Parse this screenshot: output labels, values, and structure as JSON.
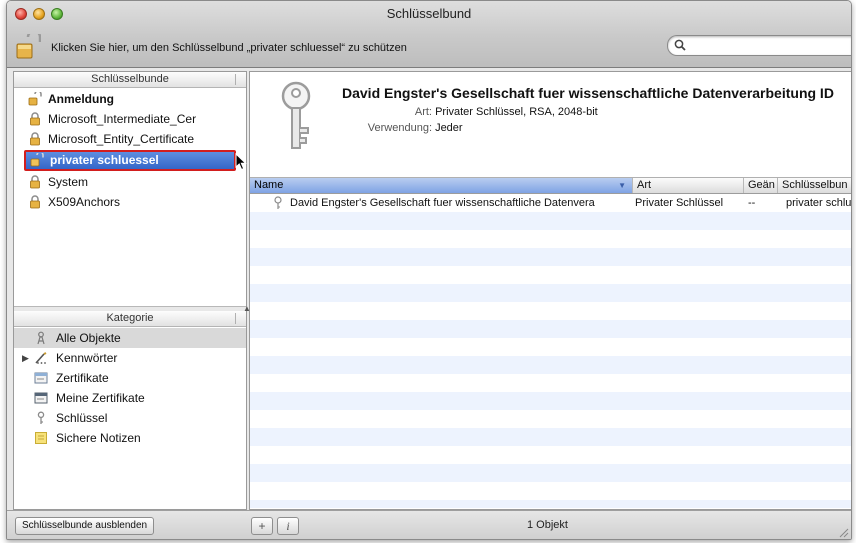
{
  "window": {
    "title": "Schlüsselbund"
  },
  "toolbar": {
    "lock_message": "Klicken Sie hier, um den Schlüsselbund „privater schluessel“ zu schützen",
    "search_placeholder": ""
  },
  "sidebar": {
    "keychains_header": "Schlüsselbunde",
    "keychains": [
      {
        "label": "Anmeldung",
        "icon": "open-lock-icon"
      },
      {
        "label": "Microsoft_Intermediate_Cer",
        "icon": "lock-icon"
      },
      {
        "label": "Microsoft_Entity_Certificate",
        "icon": "lock-icon"
      },
      {
        "label": "privater schluessel",
        "icon": "open-lock-icon"
      },
      {
        "label": "System",
        "icon": "lock-icon"
      },
      {
        "label": "X509Anchors",
        "icon": "lock-icon"
      }
    ],
    "category_header": "Kategorie",
    "categories": [
      {
        "label": "Alle Objekte",
        "icon": "all-items-icon"
      },
      {
        "label": "Kennwörter",
        "icon": "passwords-icon"
      },
      {
        "label": "Zertifikate",
        "icon": "certificate-icon"
      },
      {
        "label": "Meine Zertifikate",
        "icon": "my-certificate-icon"
      },
      {
        "label": "Schlüssel",
        "icon": "key-icon"
      },
      {
        "label": "Sichere Notizen",
        "icon": "note-icon"
      }
    ]
  },
  "detail": {
    "name": "David Engster's Gesellschaft fuer wissenschaftliche Datenverarbeitung ID",
    "kind_label": "Art:",
    "kind_value": "Privater Schlüssel, RSA, 2048-bit",
    "usage_label": "Verwendung:",
    "usage_value": "Jeder"
  },
  "table": {
    "columns": [
      "Name",
      "Art",
      "Geän",
      "Schlüsselbun"
    ],
    "rows": [
      {
        "name": "David Engster's Gesellschaft fuer wissenschaftliche Datenvera",
        "kind": "Privater Schlüssel",
        "modified": "--",
        "keychain": "privater schlu"
      }
    ]
  },
  "bottom": {
    "hide_keychains_label": "Schlüsselbunde ausblenden",
    "add_label": "+",
    "info_label": "i",
    "count": "1 Objekt"
  },
  "colors": {
    "selection": "#3466c8",
    "highlight_border": "#d21e1e",
    "row_stripe": "#edf3fe"
  }
}
